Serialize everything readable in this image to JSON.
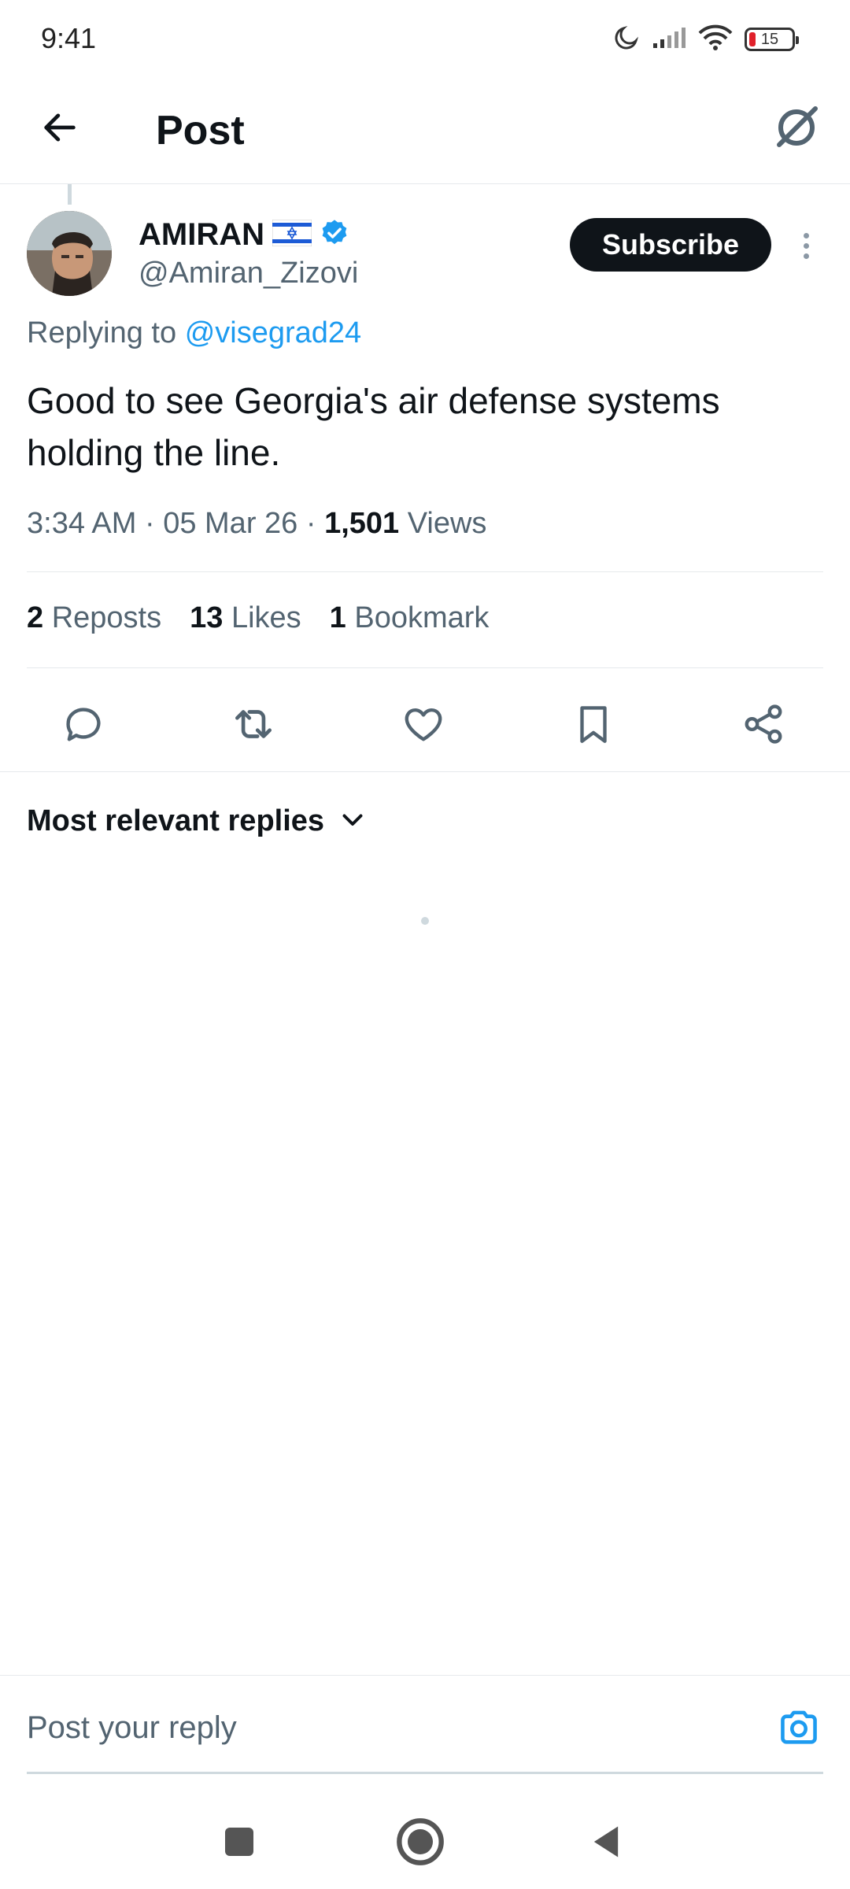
{
  "status_bar": {
    "time": "9:41",
    "battery_level": "15",
    "battery_color": "#e0212b",
    "icons": [
      "moon-icon",
      "signal-icon",
      "wifi-icon",
      "battery-icon"
    ]
  },
  "header": {
    "title": "Post",
    "back_icon": "arrow-left-icon",
    "grok_icon": "grok-icon"
  },
  "post": {
    "author_name": "AMIRAN",
    "author_flag": "🇮🇱",
    "verified": true,
    "handle": "@Amiran_Zizovi",
    "subscribe_label": "Subscribe",
    "replying_prefix": "Replying to",
    "replying_handle": "@visegrad24",
    "text": "Good to see Georgia's air defense systems holding the line.",
    "time": "3:34 AM",
    "date": "05 Mar 26",
    "views_count": "1,501",
    "views_label": "Views",
    "separator": "·"
  },
  "stats": {
    "reposts_count": "2",
    "reposts_label": "Reposts",
    "likes_count": "13",
    "likes_label": "Likes",
    "bookmarks_count": "1",
    "bookmarks_label": "Bookmark"
  },
  "actions": [
    "reply-icon",
    "repost-icon",
    "like-icon",
    "bookmark-icon",
    "share-icon"
  ],
  "replies": {
    "sort_label": "Most relevant replies"
  },
  "composer": {
    "placeholder": "Post your reply",
    "value": ""
  },
  "colors": {
    "accent": "#1d9bf0",
    "text": "#0f1419",
    "secondary": "#536471",
    "border": "#e6e9ec"
  }
}
